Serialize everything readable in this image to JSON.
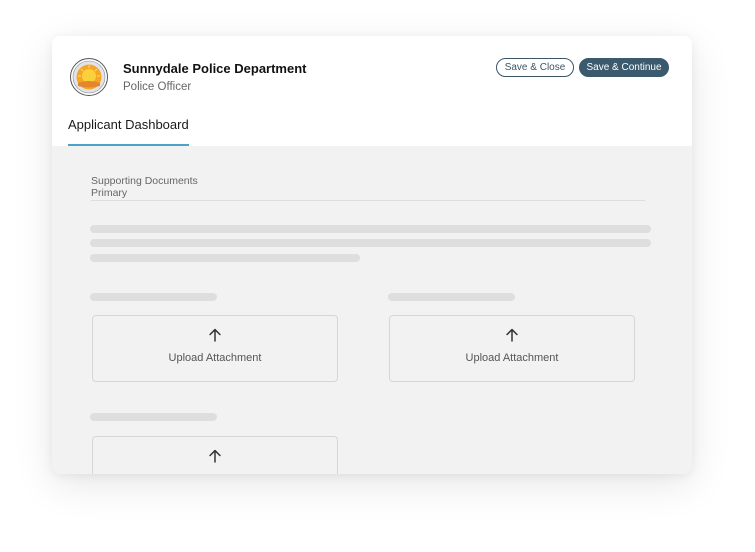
{
  "header": {
    "department": "Sunnydale Police Department",
    "role": "Police Officer",
    "save_close_label": "Save & Close",
    "save_continue_label": "Save & Continue"
  },
  "tabs": [
    {
      "label": "Applicant Dashboard",
      "active": true
    }
  ],
  "documents": {
    "title_line1": "Supporting Documents",
    "title_line2": "Primary"
  },
  "uploads": [
    {
      "label": "Upload Attachment",
      "icon": "arrow-up-icon"
    },
    {
      "label": "Upload Attachment",
      "icon": "arrow-up-icon"
    },
    {
      "label": "",
      "icon": "arrow-up-icon"
    }
  ],
  "colors": {
    "primary_button": "#3b5a6d",
    "tab_accent": "#4aa3c9",
    "card_background": "#f2f2f2",
    "skeleton": "#dedede"
  }
}
